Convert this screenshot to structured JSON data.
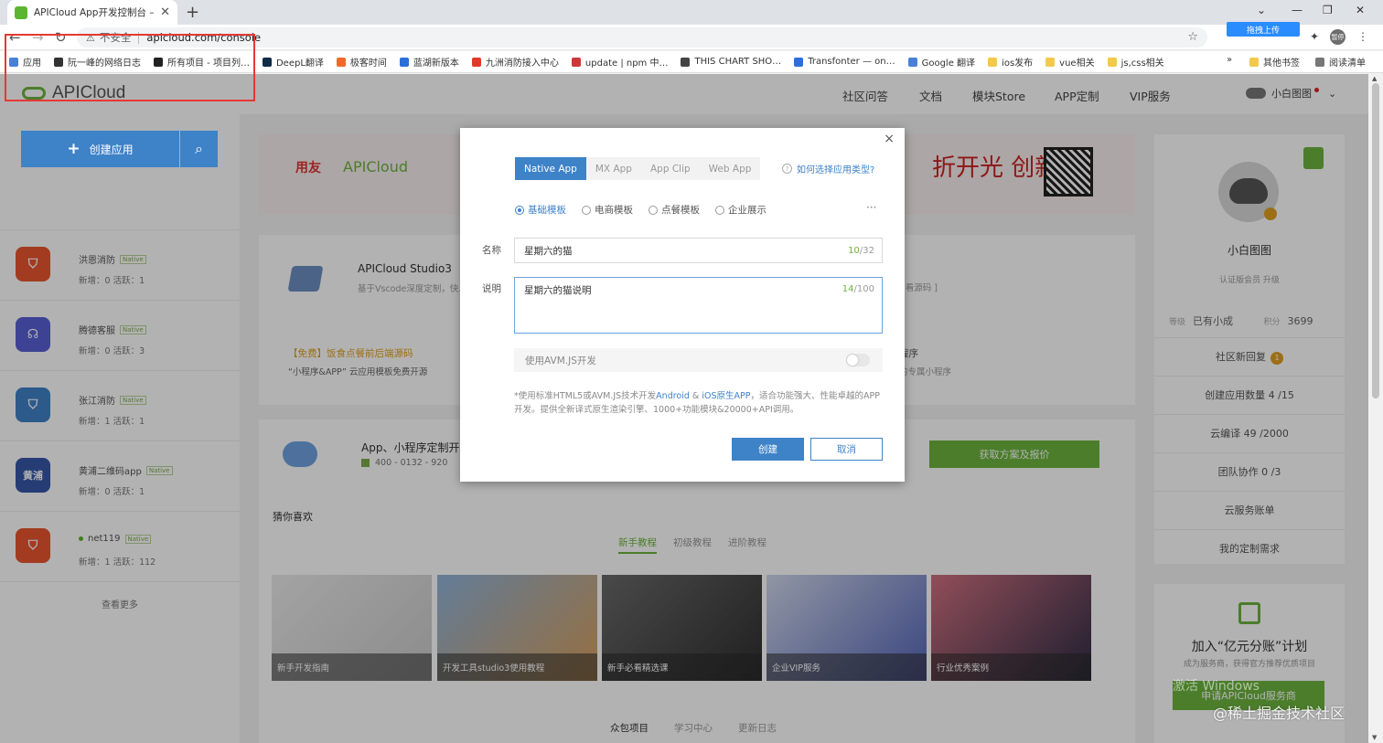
{
  "browser": {
    "tab_title": "APICloud App开发控制台 – 手…",
    "insecure_label": "不安全",
    "url": "apicloud.com/console",
    "upload_label": "拖拽上传",
    "profile_label": "暂停",
    "bookmarks": [
      {
        "label": "应用",
        "color": "#4a7fd8"
      },
      {
        "label": "阮一峰的网络日志",
        "color": "#333333"
      },
      {
        "label": "所有项目 - 项目列…",
        "color": "#222222"
      },
      {
        "label": "DeepL翻译",
        "color": "#0f2b46"
      },
      {
        "label": "极客时间",
        "color": "#f06a2a"
      },
      {
        "label": "蓝湖新版本",
        "color": "#2b6fd8"
      },
      {
        "label": "九洲消防接入中心",
        "color": "#e03a2a"
      },
      {
        "label": "update | npm 中…",
        "color": "#cb3837"
      },
      {
        "label": "THIS CHART SHO…",
        "color": "#444444"
      },
      {
        "label": "Transfonter — on…",
        "color": "#2b6fd8"
      },
      {
        "label": "Google 翻译",
        "color": "#4a7fd8"
      },
      {
        "label": "ios发布",
        "color": "#f2c94c"
      },
      {
        "label": "vue相关",
        "color": "#f2c94c"
      },
      {
        "label": "js,css相关",
        "color": "#f2c94c"
      }
    ],
    "bookmarks_right": [
      "其他书签",
      "阅读清单"
    ]
  },
  "header": {
    "logo": "APICloud",
    "nav": [
      "社区问答",
      "文档",
      "模块Store",
      "APP定制",
      "VIP服务"
    ],
    "user": "小白图图"
  },
  "sidebar": {
    "create_label": "创建应用",
    "apps": [
      {
        "name": "洪恩消防",
        "badge": "Native",
        "stat": "新增：0   活跃：1",
        "color": "#e8552f",
        "icon": "⛉"
      },
      {
        "name": "腾德客服",
        "badge": "Native",
        "stat": "新增：0   活跃：3",
        "color": "#5a5fd6",
        "icon": "☊"
      },
      {
        "name": "张江消防",
        "badge": "Native",
        "stat": "新增：1   活跃：1",
        "color": "#3e82c8",
        "icon": "⛉"
      },
      {
        "name": "黄浦二维码app",
        "badge": "Native",
        "stat": "新增：0   活跃：1",
        "color": "#3556a8",
        "icon": "黄浦"
      },
      {
        "name": "net119",
        "badge": "Native",
        "stat": "新增：1   活跃：112",
        "color": "#e8552f",
        "icon": "⛉"
      }
    ],
    "more": "查看更多"
  },
  "banner": {
    "brand1": "用友",
    "brand2": "APICloud",
    "slogan": "折开光 创新价"
  },
  "card1": {
    "studio_title": "APICloud Studio3",
    "studio_desc": "基于Vscode深度定制，快…",
    "tag": "[ 看源码 ]",
    "free_title": "【免费】饭食点餐前后端源码",
    "free_desc": "“小程序&APP” 云应用模板免费开源",
    "mini_title": "程序",
    "mini_desc": "的专属小程序"
  },
  "card2": {
    "cust_title": "App、小程序定制开发",
    "phone": "400 - 0132 - 920",
    "quote": "获取方案及报价",
    "guess": "猜你喜欢",
    "tabs": [
      "新手教程",
      "初级教程",
      "进阶教程"
    ],
    "tutorials": [
      "新手开发指南",
      "开发工具studio3使用教程",
      "新手必看精选课",
      "企业VIP服务",
      "行业优秀案例"
    ]
  },
  "card3": {
    "tabs": [
      "众包项目",
      "学习中心",
      "更新日志"
    ]
  },
  "rightbar": {
    "username": "小白图图",
    "member": "认证版会员   升级",
    "level_key": "等级",
    "level": "已有小成",
    "points_key": "积分",
    "points": "3699",
    "rows": [
      {
        "label": "社区新回复",
        "num": "1"
      },
      {
        "label": "创建应用数量 4 /15"
      },
      {
        "label": "云编译 49 /2000"
      },
      {
        "label": "团队协作 0 /3"
      },
      {
        "label": "云服务账单"
      },
      {
        "label": "我的定制需求"
      }
    ]
  },
  "promo": {
    "title": "加入“亿元分账”计划",
    "desc": "成为服务商，获得官方推荐优质项目",
    "btn": "申请APICloud服务商"
  },
  "watermark": {
    "activate": "激活 Windows",
    "site": "@稀土掘金技术社区"
  },
  "modal": {
    "close": "×",
    "tabs": [
      "Native App",
      "MX App",
      "App Clip",
      "Web App"
    ],
    "help": "如何选择应用类型?",
    "templates": [
      "基础模板",
      "电商模板",
      "点餐模板",
      "企业展示"
    ],
    "name_label": "名称",
    "name_value": "星期六的猫",
    "name_count": "10",
    "name_max": "/32",
    "desc_label": "说明",
    "desc_value": "星期六的猫说明",
    "desc_count": "14",
    "desc_max": "/100",
    "avm_label": "使用AVM.JS开发",
    "note_prefix": "*使用标准HTML5或AVM.JS技术开发",
    "note_android": "Android",
    "note_and": " & ",
    "note_ios": "iOS原生APP",
    "note_suffix": "，适合功能强大、性能卓越的APP开发。提供全新译式原生渲染引擎、1000+功能模块&20000+API调用。",
    "create": "创建",
    "cancel": "取消"
  }
}
